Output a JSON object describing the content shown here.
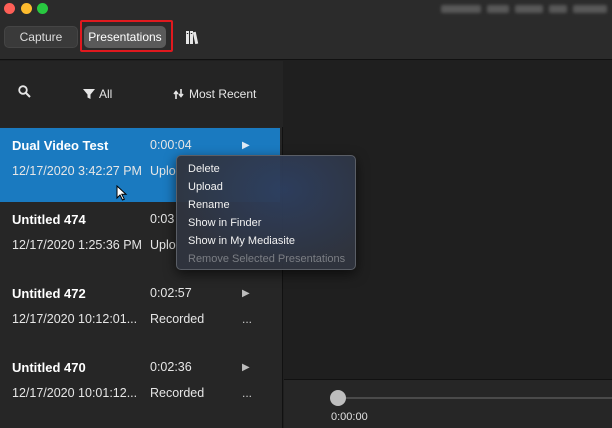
{
  "toolbar": {
    "tabs": [
      {
        "label": "Capture",
        "selected": false
      },
      {
        "label": "Presentations",
        "selected": true
      }
    ],
    "library_icon": "books-icon"
  },
  "filterbar": {
    "search_icon": "search-icon",
    "filter_label": "All",
    "filter_icon": "funnel-icon",
    "sort_label": "Most Recent",
    "sort_icon": "sort-icon"
  },
  "presentations": [
    {
      "title": "Dual Video Test",
      "date": "12/17/2020 3:42:27 PM",
      "duration": "0:00:04",
      "status": "Uplo",
      "selected": true
    },
    {
      "title": "Untitled 474",
      "date": "12/17/2020 1:25:36 PM",
      "duration": "0:03",
      "status": "Uplo",
      "selected": false
    },
    {
      "title": "Untitled 472",
      "date": "12/17/2020 10:12:01...",
      "duration": "0:02:57",
      "status": "Recorded",
      "selected": false
    },
    {
      "title": "Untitled 470",
      "date": "12/17/2020 10:01:12...",
      "duration": "0:02:36",
      "status": "Recorded",
      "selected": false
    }
  ],
  "row_icons": {
    "play": "▶",
    "more": "..."
  },
  "context_menu": {
    "items": [
      {
        "label": "Delete",
        "enabled": true
      },
      {
        "label": "Upload",
        "enabled": true
      },
      {
        "label": "Rename",
        "enabled": true
      },
      {
        "label": "Show in Finder",
        "enabled": true
      },
      {
        "label": "Show in My Mediasite",
        "enabled": true
      },
      {
        "label": "Remove Selected Presentations",
        "enabled": false
      }
    ]
  },
  "player": {
    "current_time": "0:00:00"
  },
  "colors": {
    "selection": "#1a7ac0",
    "highlight_box": "#e0191e"
  }
}
